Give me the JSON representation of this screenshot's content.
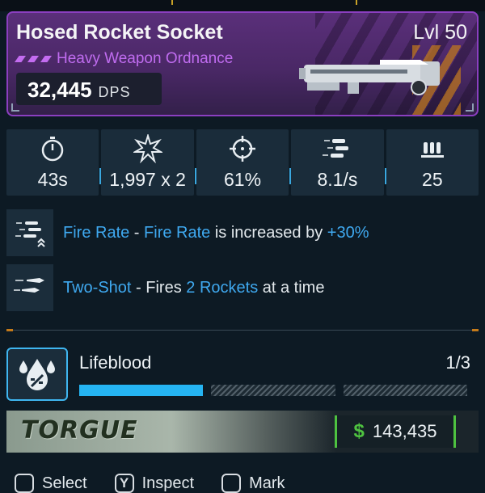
{
  "item": {
    "name": "Hosed Rocket Socket",
    "level": "Lvl 50",
    "type": "Heavy Weapon Ordnance",
    "dps_value": "32,445",
    "dps_label": "DPS",
    "rarity_color": "#c06cf0"
  },
  "stats": [
    {
      "icon": "stopwatch-icon",
      "value": "43s"
    },
    {
      "icon": "explosion-icon",
      "value": "1,997 x 2"
    },
    {
      "icon": "crosshair-icon",
      "value": "61%"
    },
    {
      "icon": "bullets-firerate-icon",
      "value": "8.1/s"
    },
    {
      "icon": "ammo-icon",
      "value": "25"
    }
  ],
  "perks": [
    {
      "icon": "fire-rate-perk-icon",
      "name": "Fire Rate",
      "sep": " - ",
      "part1": "Fire Rate",
      "part2": " is increased by ",
      "part3": "+30%"
    },
    {
      "icon": "two-shot-perk-icon",
      "name": "Two-Shot",
      "sep": " - ",
      "part1": "Fires ",
      "part2": "2 Rockets",
      "part3": " at a time"
    }
  ],
  "mod": {
    "icon": "lifeblood-icon",
    "name": "Lifeblood",
    "count": "1/3",
    "progress": 0.333
  },
  "manufacturer": {
    "logo_text": "TORGUE",
    "currency_icon": "$",
    "price": "143,435"
  },
  "actions": [
    {
      "glyph": "",
      "label": "Select"
    },
    {
      "glyph": "Y",
      "label": "Inspect"
    },
    {
      "glyph": "",
      "label": "Mark"
    }
  ],
  "colors": {
    "accent_blue": "#3fa9f0",
    "rarity_purple": "#8b3fc0",
    "money_green": "#4ec240"
  }
}
